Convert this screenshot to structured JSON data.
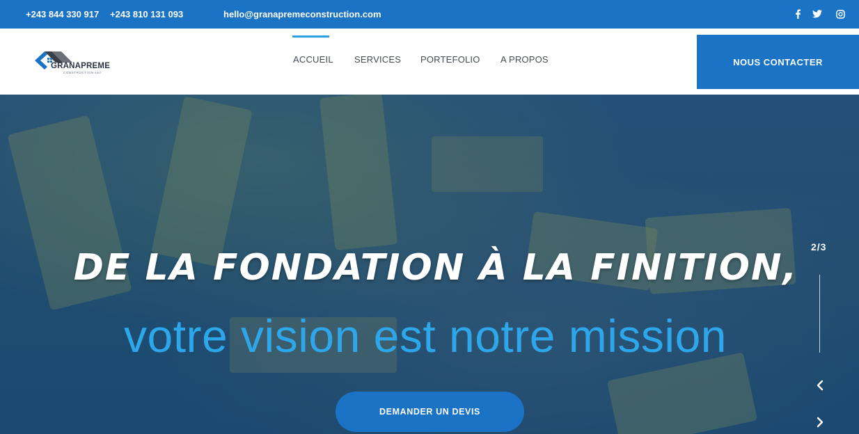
{
  "topbar": {
    "phone1": "+243 844 330 917",
    "phone2": "+243 810 131 093",
    "email": "hello@granapremeconstruction.com",
    "social_icons": [
      "facebook-icon",
      "twitter-icon",
      "instagram-icon"
    ],
    "background": "#1a73c4"
  },
  "header": {
    "logo": {
      "name": "GRANAPREME",
      "sub": "CONSTRUCTION sarl"
    },
    "nav": [
      "ACCUEIL",
      "SERVICES",
      "PORTEFOLIO",
      "A PROPOS"
    ],
    "active_nav": "ACCUEIL",
    "contact_label": "NOUS CONTACTER"
  },
  "hero": {
    "headline": "De la fondation à la finition,",
    "subline": "votre vision est notre mission",
    "cta_label": "DEMANDER UN DEVIS",
    "slide_counter": "2/3",
    "accent": "#2ea7ea",
    "prev_icon": "chevron-left-icon",
    "next_icon": "chevron-right-icon"
  }
}
